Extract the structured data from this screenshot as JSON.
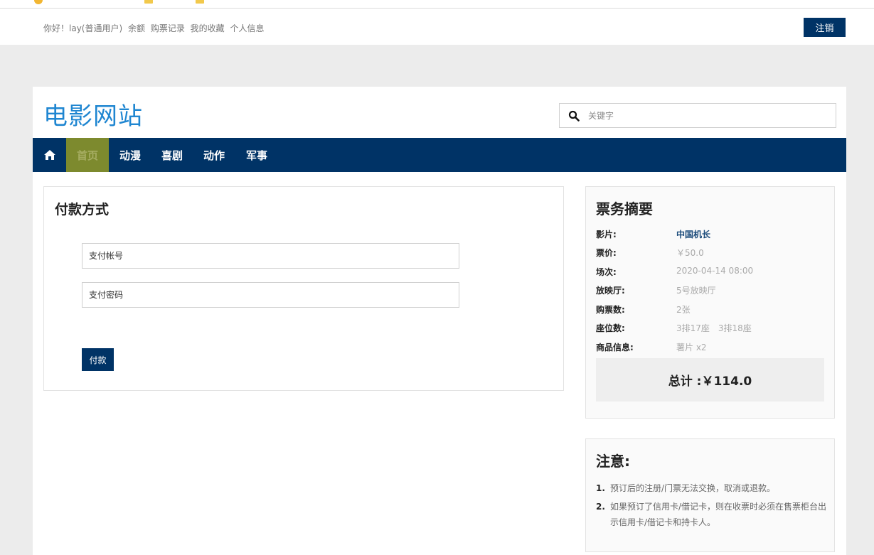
{
  "topbar": {
    "greeting": "你好！lay(普通用户)",
    "links": [
      "余额",
      "购票记录",
      "我的收藏",
      "个人信息"
    ],
    "logout_label": "注销"
  },
  "site": {
    "title": "电影网站"
  },
  "search": {
    "placeholder": "关键字",
    "icon": "search-icon"
  },
  "nav": {
    "home_icon": "home-icon",
    "items": [
      "首页",
      "动漫",
      "喜剧",
      "动作",
      "军事"
    ],
    "active_index": 0
  },
  "payment": {
    "title": "付款方式",
    "account_placeholder": "支付帐号",
    "password_placeholder": "支付密码",
    "submit_label": "付款"
  },
  "summary": {
    "title": "票务摘要",
    "rows": [
      {
        "label": "影片:",
        "value": "中国机长"
      },
      {
        "label": "票价:",
        "value": "￥50.0"
      },
      {
        "label": "场次:",
        "value": "2020-04-14 08:00"
      },
      {
        "label": "放映厅:",
        "value": "5号放映厅"
      },
      {
        "label": "购票数:",
        "value": "2张"
      },
      {
        "label": "座位数:",
        "value": "3排17座　3排18座"
      },
      {
        "label": "商品信息:",
        "value": "薯片 x2"
      }
    ],
    "total": "总计 :￥114.0"
  },
  "notice": {
    "title": "注意:",
    "items": [
      {
        "num": "1.",
        "text": "预订后的注册/门票无法交换，取消或退款。"
      },
      {
        "num": "2.",
        "text": "如果预订了信用卡/借记卡，则在收票时必须在售票柜台出示信用卡/借记卡和持卡人。"
      }
    ]
  },
  "colors": {
    "brand_navy": "#003366",
    "title_blue": "#1f86d1",
    "active_nav": "#7d8a2e"
  }
}
